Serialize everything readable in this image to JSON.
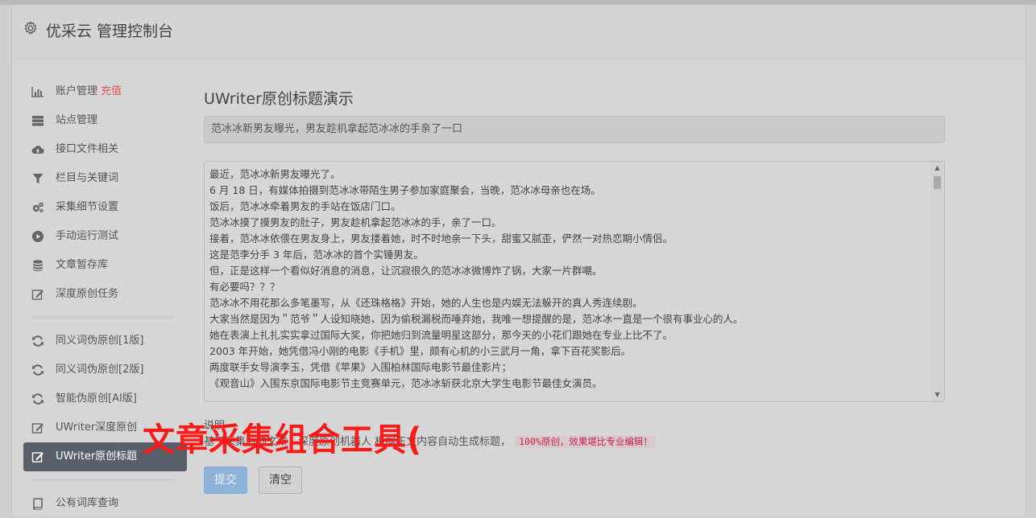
{
  "header": {
    "title": "优采云 管理控制台"
  },
  "sidebar": {
    "items": [
      {
        "label": "账户管理",
        "badge": "充值"
      },
      {
        "label": "站点管理"
      },
      {
        "label": "接口文件相关"
      },
      {
        "label": "栏目与关键词"
      },
      {
        "label": "采集细节设置"
      },
      {
        "label": "手动运行测试"
      },
      {
        "label": "文章暂存库"
      },
      {
        "label": "深度原创任务"
      },
      {
        "label": "同义词伪原创[1版]"
      },
      {
        "label": "同义词伪原创[2版]"
      },
      {
        "label": "智能伪原创[AI版]"
      },
      {
        "label": "UWriter深度原创"
      },
      {
        "label": "UWriter原创标题"
      },
      {
        "label": "公有词库查询"
      }
    ]
  },
  "main": {
    "page_title": "UWriter原创标题演示",
    "title_value": "范冰冰新男友曝光，男友趁机拿起范冰冰的手亲了一口",
    "body_lines": [
      "最近，范冰冰新男友曝光了。",
      "6 月 18 日，有媒体拍摄到范冰冰带陌生男子参加家庭聚会，当晚，范冰冰母亲也在场。",
      "饭后，范冰冰牵着男友的手站在饭店门口。",
      "范冰冰摸了摸男友的肚子，男友趁机拿起范冰冰的手，亲了一口。",
      "接着，范冰冰依偎在男友身上，男友搂着她，时不时地亲一下头，甜蜜又腻歪，俨然一对热恋期小情侣。",
      "这是范李分手 3 年后，范冰冰的首个实锤男友。",
      "但，正是这样一个看似好消息的消息，让沉寂很久的范冰冰微博炸了锅，大家一片群嘲。",
      "有必要吗？？？",
      "范冰冰不用花那么多笔墨写，从《还珠格格》开始，她的人生也是内娱无法躲开的真人秀连续剧。",
      "大家当然是因为＂范爷＂人设知晓她，因为偷税漏税而唾弃她，我唯一想提醒的是，范冰冰一直是一个很有事业心的人。",
      "她在表演上扎扎实实拿过国际大奖，你把她归到流量明星这部分，那今天的小花们跟她在专业上比不了。",
      "2003 年开始，她凭借冯小刚的电影《手机》里，颇有心机的小三武月一角，拿下百花奖影后。",
      "两度联手女导演李玉，凭借《苹果》入围柏林国际电影节最佳影片；",
      "《观音山》入围东京国际电影节主竞赛单元，范冰冰斩获北京大学生电影节最佳女演员。"
    ],
    "explain_label": "说明",
    "explain_text": "基于采集后的文章，深度原创机器人 根据正文内容自动生成标题，",
    "explain_code": "100%原创，效果堪比专业编辑！",
    "overlay_text": "文章采集组合工具(",
    "submit_label": "提交",
    "clear_label": "清空"
  },
  "colors": {
    "active_nav": "#5a6069",
    "submit": "#8fb3d8",
    "overlay": "#ff1a1a",
    "badge": "#d9534f"
  }
}
